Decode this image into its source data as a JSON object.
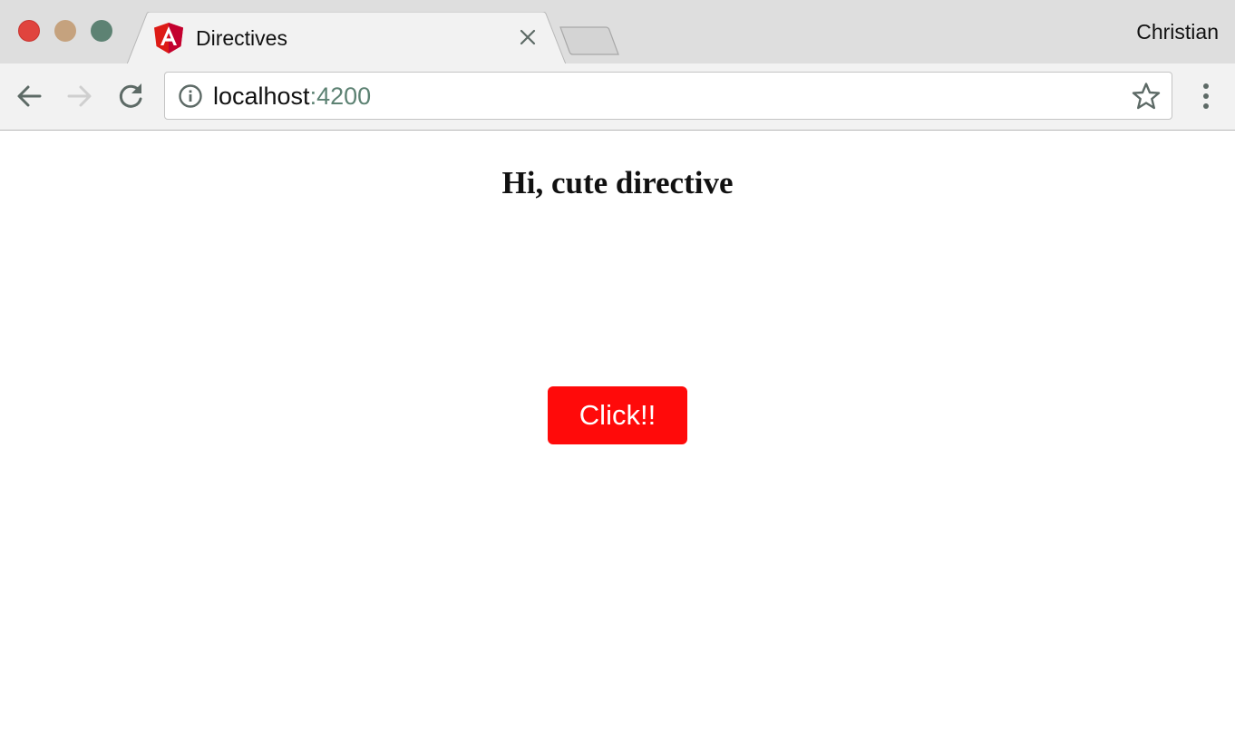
{
  "window": {
    "profile_name": "Christian"
  },
  "tab": {
    "title": "Directives",
    "favicon": "angular-icon"
  },
  "toolbar": {
    "url_host": "localhost",
    "url_port": ":4200"
  },
  "page": {
    "heading": "Hi, cute directive",
    "button_label": "Click!!"
  },
  "colors": {
    "accent_button": "#ff0a0a",
    "url_port": "#5d8273",
    "angular_red": "#dd1b16"
  }
}
